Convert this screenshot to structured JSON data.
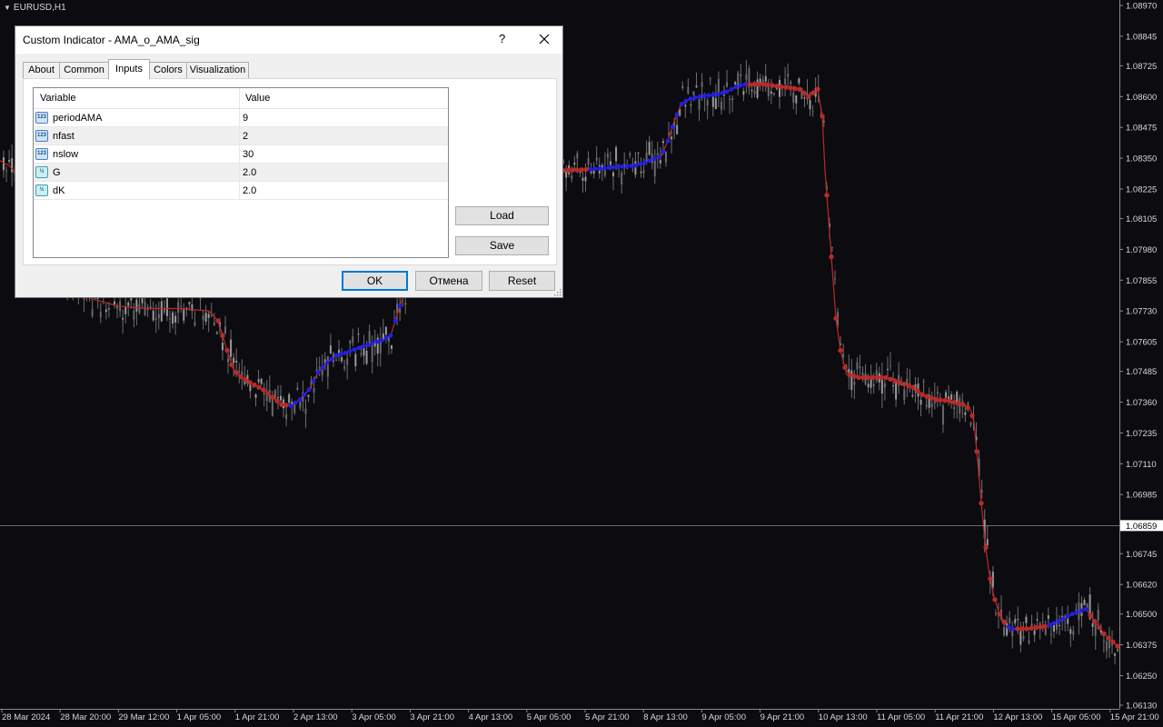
{
  "chart": {
    "symbol": "EURUSD,H1",
    "current_price": "1.06859",
    "price_labels": [
      "1.08970",
      "1.08845",
      "1.08725",
      "1.08600",
      "1.08475",
      "1.08350",
      "1.08225",
      "1.08105",
      "1.07980",
      "1.07855",
      "1.07730",
      "1.07605",
      "1.07485",
      "1.07360",
      "1.07235",
      "1.07110",
      "1.06985",
      "1.06745",
      "1.06620",
      "1.06500",
      "1.06375",
      "1.06250",
      "1.06130"
    ],
    "time_labels": [
      "28 Mar 2024",
      "28 Mar 20:00",
      "29 Mar 12:00",
      "1 Apr 05:00",
      "1 Apr 21:00",
      "2 Apr 13:00",
      "3 Apr 05:00",
      "3 Apr 21:00",
      "4 Apr 13:00",
      "5 Apr 05:00",
      "5 Apr 21:00",
      "8 Apr 13:00",
      "9 Apr 05:00",
      "9 Apr 21:00",
      "10 Apr 13:00",
      "11 Apr 05:00",
      "11 Apr 21:00",
      "12 Apr 13:00",
      "15 Apr 05:00",
      "15 Apr 21:00"
    ],
    "colors": {
      "background": "#0b0b10",
      "candle": "#8c8c8c",
      "line_down": "#c02828",
      "dot_down": "#b82a2a",
      "dot_up": "#1e1ef0",
      "text": "#d8d8d8"
    },
    "ama_curve": [
      [
        0,
        1.0834
      ],
      [
        10,
        1.0832
      ],
      [
        20,
        1.0828
      ],
      [
        30,
        1.082
      ],
      [
        50,
        1.0806
      ],
      [
        80,
        1.0785
      ],
      [
        100,
        1.0778
      ],
      [
        130,
        1.0775
      ],
      [
        160,
        1.0774
      ],
      [
        200,
        1.0774
      ],
      [
        230,
        1.0773
      ],
      [
        240,
        1.0769
      ],
      [
        245,
        1.0763
      ],
      [
        250,
        1.0757
      ],
      [
        256,
        1.075
      ],
      [
        262,
        1.0747
      ],
      [
        275,
        1.0744
      ],
      [
        290,
        1.0741
      ],
      [
        300,
        1.0738
      ],
      [
        310,
        1.0735
      ],
      [
        320,
        1.07345
      ],
      [
        330,
        1.0737
      ],
      [
        340,
        1.0741
      ],
      [
        350,
        1.0748
      ],
      [
        360,
        1.0752
      ],
      [
        370,
        1.0755
      ],
      [
        380,
        1.0756
      ],
      [
        395,
        1.0758
      ],
      [
        410,
        1.076
      ],
      [
        420,
        1.0761
      ],
      [
        430,
        1.0763
      ],
      [
        440,
        1.0775
      ],
      [
        460,
        1.0795
      ],
      [
        480,
        1.0815
      ],
      [
        500,
        1.0825
      ],
      [
        540,
        1.0826
      ],
      [
        580,
        1.0828
      ],
      [
        620,
        1.083
      ],
      [
        650,
        1.08305
      ],
      [
        680,
        1.08315
      ],
      [
        700,
        1.0832
      ],
      [
        715,
        1.0834
      ],
      [
        728,
        1.0836
      ],
      [
        735,
        1.0842
      ],
      [
        742,
        1.085
      ],
      [
        750,
        1.0857
      ],
      [
        758,
        1.0859
      ],
      [
        770,
        1.086
      ],
      [
        790,
        1.0861
      ],
      [
        800,
        1.0862
      ],
      [
        810,
        1.0864
      ],
      [
        820,
        1.0865
      ],
      [
        840,
        1.0865
      ],
      [
        860,
        1.0864
      ],
      [
        880,
        1.0863
      ],
      [
        890,
        1.086
      ],
      [
        900,
        1.0863
      ],
      [
        905,
        1.0852
      ],
      [
        908,
        1.083
      ],
      [
        912,
        1.081
      ],
      [
        916,
        1.079
      ],
      [
        920,
        1.077
      ],
      [
        925,
        1.0757
      ],
      [
        930,
        1.075
      ],
      [
        935,
        1.0747
      ],
      [
        945,
        1.0746
      ],
      [
        960,
        1.0746
      ],
      [
        975,
        1.0746
      ],
      [
        990,
        1.0744
      ],
      [
        1005,
        1.0742
      ],
      [
        1015,
        1.0739
      ],
      [
        1030,
        1.0737
      ],
      [
        1045,
        1.07365
      ],
      [
        1060,
        1.0735
      ],
      [
        1068,
        1.0733
      ],
      [
        1072,
        1.0728
      ],
      [
        1076,
        1.0712
      ],
      [
        1080,
        1.0695
      ],
      [
        1084,
        1.068
      ],
      [
        1088,
        1.0668
      ],
      [
        1094,
        1.0657
      ],
      [
        1100,
        1.065
      ],
      [
        1108,
        1.0645
      ],
      [
        1115,
        1.0644
      ],
      [
        1130,
        1.0644
      ],
      [
        1150,
        1.0645
      ],
      [
        1165,
        1.0647
      ],
      [
        1180,
        1.065
      ],
      [
        1195,
        1.0652
      ],
      [
        1205,
        1.0647
      ],
      [
        1215,
        1.0642
      ],
      [
        1230,
        1.0637
      ]
    ],
    "blue_segments": [
      [
        318,
        350
      ],
      [
        342,
        440
      ],
      [
        650,
        736
      ],
      [
        740,
        820
      ],
      [
        1108,
        1118
      ],
      [
        1155,
        1198
      ]
    ]
  },
  "dialog": {
    "title": "Custom Indicator - AMA_o_AMA_sig",
    "help": "?",
    "close_icon": "close-icon",
    "tabs": [
      "About",
      "Common",
      "Inputs",
      "Colors",
      "Visualization"
    ],
    "active_tab": "Inputs",
    "table": {
      "headers": [
        "Variable",
        "Value"
      ],
      "rows": [
        {
          "icon": "int-param-icon",
          "icon_text": "123",
          "name": "periodAMA",
          "value": "9"
        },
        {
          "icon": "int-param-icon",
          "icon_text": "123",
          "name": "nfast",
          "value": "2"
        },
        {
          "icon": "int-param-icon",
          "icon_text": "123",
          "name": "nslow",
          "value": "30"
        },
        {
          "icon": "double-param-icon",
          "icon_text": "½",
          "name": "G",
          "value": "2.0"
        },
        {
          "icon": "double-param-icon",
          "icon_text": "½",
          "name": "dK",
          "value": "2.0"
        }
      ]
    },
    "buttons": {
      "load": "Load",
      "save": "Save",
      "ok": "OK",
      "cancel": "Отмена",
      "reset": "Reset"
    }
  }
}
